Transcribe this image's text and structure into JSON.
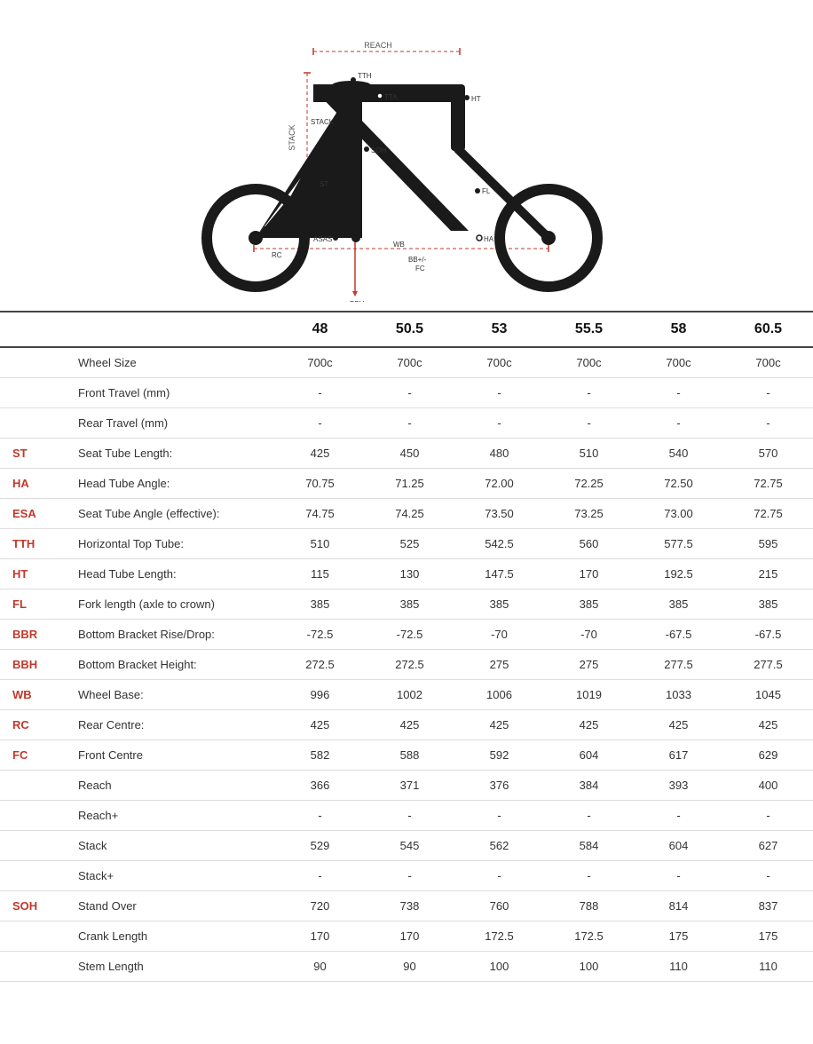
{
  "diagram": {
    "alt": "Bike frame geometry diagram"
  },
  "sizes": [
    "48",
    "50.5",
    "53",
    "55.5",
    "58",
    "60.5"
  ],
  "rows": [
    {
      "abbr": "",
      "param": "Wheel Size",
      "values": [
        "700c",
        "700c",
        "700c",
        "700c",
        "700c",
        "700c"
      ]
    },
    {
      "abbr": "",
      "param": "Front Travel (mm)",
      "values": [
        "-",
        "-",
        "-",
        "-",
        "-",
        "-"
      ]
    },
    {
      "abbr": "",
      "param": "Rear Travel (mm)",
      "values": [
        "-",
        "-",
        "-",
        "-",
        "-",
        "-"
      ]
    },
    {
      "abbr": "ST",
      "param": "Seat Tube Length:",
      "values": [
        "425",
        "450",
        "480",
        "510",
        "540",
        "570"
      ]
    },
    {
      "abbr": "HA",
      "param": "Head Tube Angle:",
      "values": [
        "70.75",
        "71.25",
        "72.00",
        "72.25",
        "72.50",
        "72.75"
      ]
    },
    {
      "abbr": "ESA",
      "param": "Seat Tube Angle (effective):",
      "values": [
        "74.75",
        "74.25",
        "73.50",
        "73.25",
        "73.00",
        "72.75"
      ]
    },
    {
      "abbr": "TTH",
      "param": "Horizontal Top Tube:",
      "values": [
        "510",
        "525",
        "542.5",
        "560",
        "577.5",
        "595"
      ]
    },
    {
      "abbr": "HT",
      "param": "Head Tube Length:",
      "values": [
        "115",
        "130",
        "147.5",
        "170",
        "192.5",
        "215"
      ]
    },
    {
      "abbr": "FL",
      "param": "Fork length (axle to crown)",
      "values": [
        "385",
        "385",
        "385",
        "385",
        "385",
        "385"
      ]
    },
    {
      "abbr": "BBR",
      "param": "Bottom Bracket Rise/Drop:",
      "values": [
        "-72.5",
        "-72.5",
        "-70",
        "-70",
        "-67.5",
        "-67.5"
      ]
    },
    {
      "abbr": "BBH",
      "param": "Bottom Bracket Height:",
      "values": [
        "272.5",
        "272.5",
        "275",
        "275",
        "277.5",
        "277.5"
      ]
    },
    {
      "abbr": "WB",
      "param": "Wheel Base:",
      "values": [
        "996",
        "1002",
        "1006",
        "1019",
        "1033",
        "1045"
      ]
    },
    {
      "abbr": "RC",
      "param": "Rear Centre:",
      "values": [
        "425",
        "425",
        "425",
        "425",
        "425",
        "425"
      ]
    },
    {
      "abbr": "FC",
      "param": "Front Centre",
      "values": [
        "582",
        "588",
        "592",
        "604",
        "617",
        "629"
      ]
    },
    {
      "abbr": "",
      "param": "Reach",
      "values": [
        "366",
        "371",
        "376",
        "384",
        "393",
        "400"
      ]
    },
    {
      "abbr": "",
      "param": "Reach+",
      "values": [
        "-",
        "-",
        "-",
        "-",
        "-",
        "-"
      ]
    },
    {
      "abbr": "",
      "param": "Stack",
      "values": [
        "529",
        "545",
        "562",
        "584",
        "604",
        "627"
      ]
    },
    {
      "abbr": "",
      "param": "Stack+",
      "values": [
        "-",
        "-",
        "-",
        "-",
        "-",
        "-"
      ]
    },
    {
      "abbr": "SOH",
      "param": "Stand Over",
      "values": [
        "720",
        "738",
        "760",
        "788",
        "814",
        "837"
      ]
    },
    {
      "abbr": "",
      "param": "Crank Length",
      "values": [
        "170",
        "170",
        "172.5",
        "172.5",
        "175",
        "175"
      ]
    },
    {
      "abbr": "",
      "param": "Stem Length",
      "values": [
        "90",
        "90",
        "100",
        "100",
        "110",
        "110"
      ]
    }
  ]
}
